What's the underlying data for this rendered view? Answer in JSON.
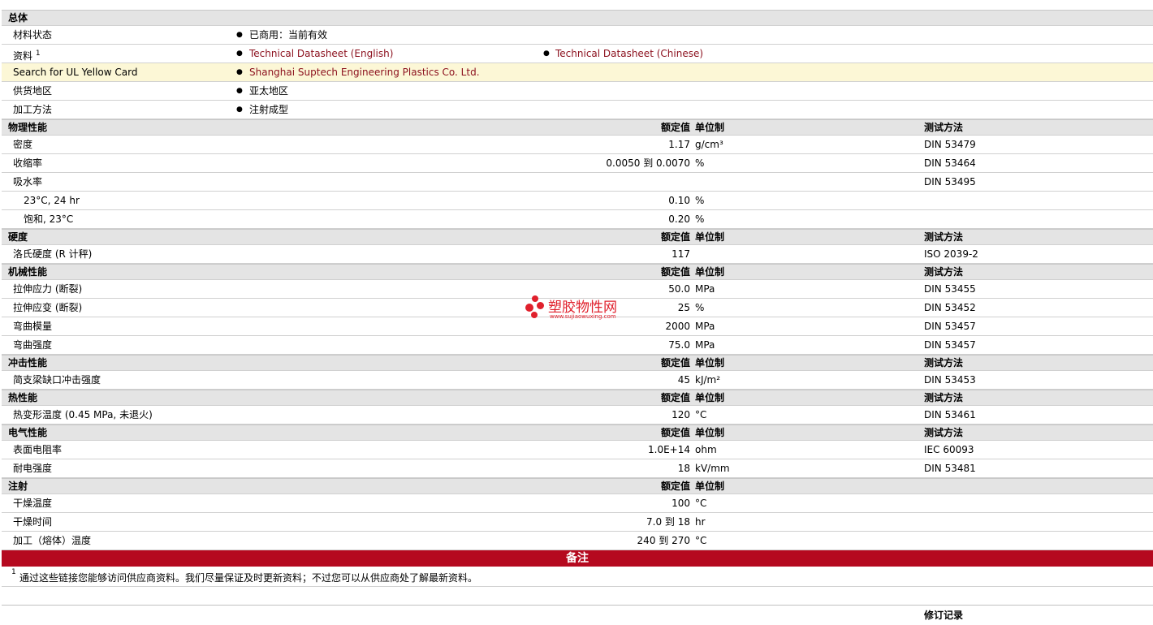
{
  "general": {
    "header": "总体",
    "rows": {
      "material_status": {
        "label": "材料状态",
        "value": "已商用：当前有效"
      },
      "docs": {
        "label": "资料",
        "footnote_mark": "1",
        "link1": "Technical Datasheet (English)",
        "link2": "Technical Datasheet (Chinese)"
      },
      "ul": {
        "label": "Search for UL Yellow Card",
        "value": "Shanghai Suptech Engineering Plastics Co. Ltd."
      },
      "region": {
        "label": "供货地区",
        "value": "亚太地区"
      },
      "process": {
        "label": "加工方法",
        "value": "注射成型"
      }
    }
  },
  "columns": {
    "nominal": "额定值",
    "unit": "单位制",
    "method": "测试方法"
  },
  "sections": {
    "physical": {
      "title": "物理性能",
      "rows": [
        {
          "label": "密度",
          "nominal": "1.17",
          "unit": "g/cm³",
          "method": "DIN 53479"
        },
        {
          "label": "收缩率",
          "nominal": "0.0050 到  0.0070",
          "unit": "%",
          "method": "DIN 53464"
        },
        {
          "label": "吸水率",
          "nominal": "",
          "unit": "",
          "method": "DIN 53495"
        },
        {
          "label": "23°C, 24 hr",
          "nominal": "0.10",
          "unit": "%",
          "method": ""
        },
        {
          "label": "饱和, 23°C",
          "nominal": "0.20",
          "unit": "%",
          "method": ""
        }
      ]
    },
    "hardness": {
      "title": "硬度",
      "rows": [
        {
          "label": "洛氏硬度 (R 计秤)",
          "nominal": "117",
          "unit": "",
          "method": "ISO 2039-2"
        }
      ]
    },
    "mechanical": {
      "title": "机械性能",
      "rows": [
        {
          "label": "拉伸应力 (断裂)",
          "nominal": "50.0",
          "unit": "MPa",
          "method": "DIN 53455"
        },
        {
          "label": "拉伸应变 (断裂)",
          "nominal": "25",
          "unit": "%",
          "method": "DIN 53452"
        },
        {
          "label": "弯曲模量",
          "nominal": "2000",
          "unit": "MPa",
          "method": "DIN 53457"
        },
        {
          "label": "弯曲强度",
          "nominal": "75.0",
          "unit": "MPa",
          "method": "DIN 53457"
        }
      ]
    },
    "impact": {
      "title": "冲击性能",
      "rows": [
        {
          "label": "简支梁缺口冲击强度",
          "nominal": "45",
          "unit": "kJ/m²",
          "method": "DIN 53453"
        }
      ]
    },
    "thermal": {
      "title": "热性能",
      "rows": [
        {
          "label": "热变形温度 (0.45 MPa, 未退火)",
          "nominal": "120",
          "unit": "°C",
          "method": "DIN 53461"
        }
      ]
    },
    "electrical": {
      "title": "电气性能",
      "rows": [
        {
          "label": "表面电阻率",
          "nominal": "1.0E+14",
          "unit": "ohm",
          "method": "IEC 60093"
        },
        {
          "label": "耐电强度",
          "nominal": "18",
          "unit": "kV/mm",
          "method": "DIN 53481"
        }
      ]
    },
    "injection": {
      "title": "注射",
      "rows": [
        {
          "label": "干燥温度",
          "nominal": "100",
          "unit": "°C",
          "method": ""
        },
        {
          "label": "干燥时间",
          "nominal": "7.0 到  18",
          "unit": "hr",
          "method": ""
        },
        {
          "label": "加工（熔体）温度",
          "nominal": "240 到  270",
          "unit": "°C",
          "method": ""
        }
      ]
    }
  },
  "notes": {
    "title": "备注",
    "mark": "1",
    "text": "通过这些链接您能够访问供应商资料。我们尽量保证及时更新资料；不过您可以从供应商处了解最新资料。"
  },
  "footer": {
    "revision": "修订记录"
  },
  "watermark": {
    "name": "塑胶物性网",
    "url": "www.sujiaowuxing.com",
    "color": "#e0202c"
  },
  "colors": {
    "link": "#8b0f1c",
    "notes_bar": "#b5091f",
    "highlight_row": "#fcf7d6",
    "header_row": "#e4e4e4"
  }
}
